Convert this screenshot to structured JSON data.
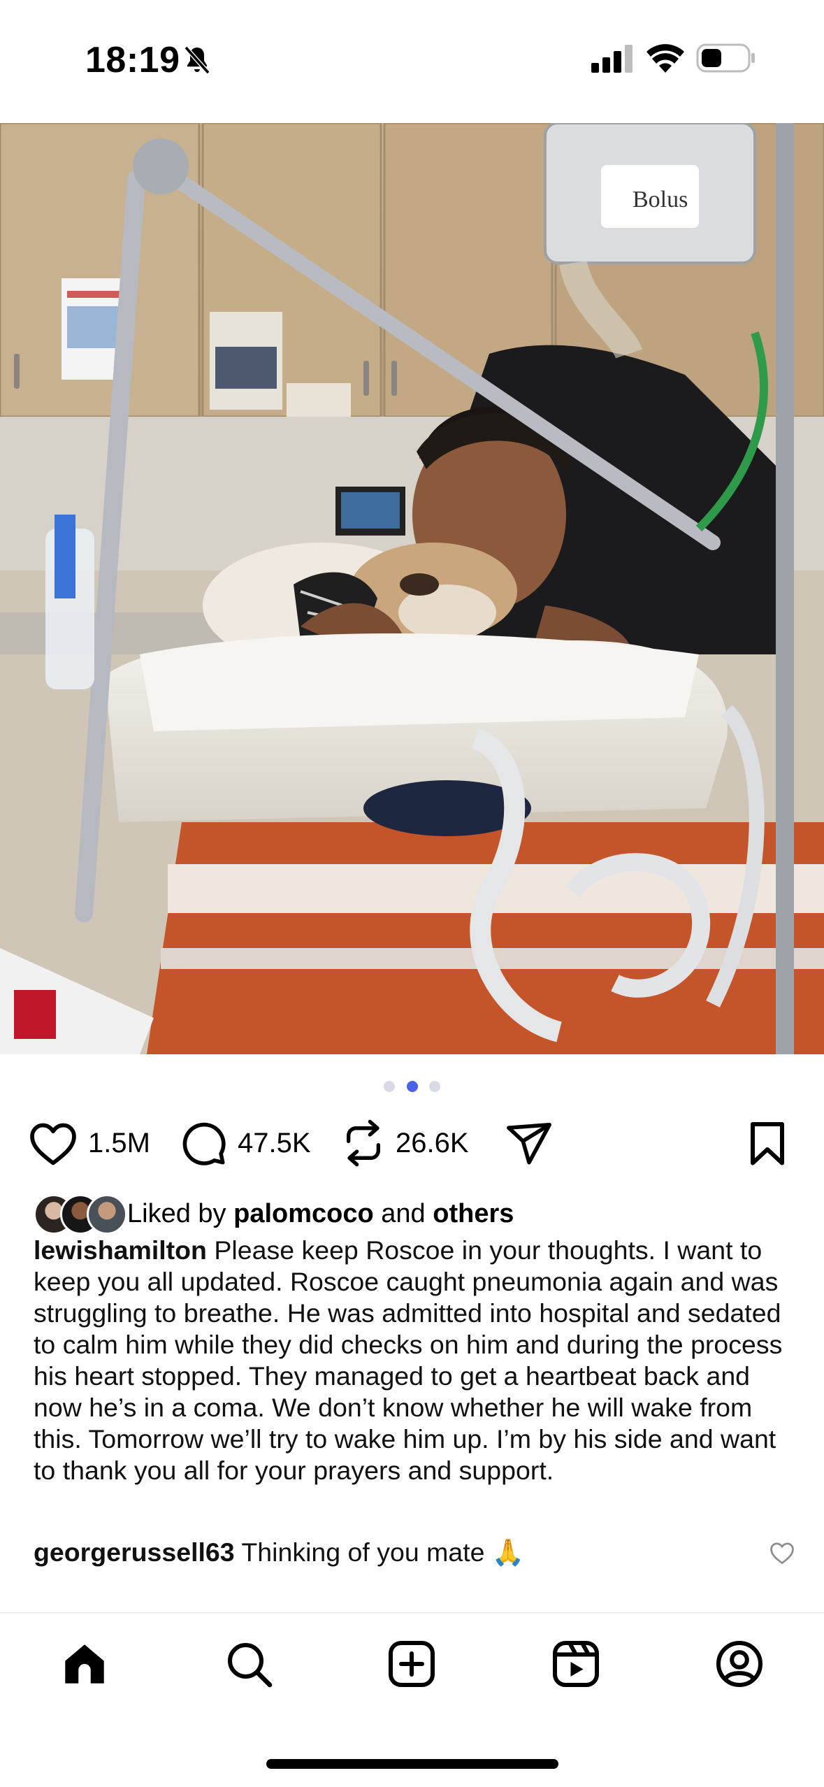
{
  "status_bar": {
    "time": "18:19",
    "icons": [
      "bell-slash-icon",
      "signal-icon",
      "wifi-icon",
      "battery-icon"
    ]
  },
  "post": {
    "image_alt": "Photo: person kissing a sedated bulldog in a veterinary hospital",
    "image_note_text": "Bolus",
    "carousel": {
      "total": 3,
      "active_index": 1
    },
    "actions": {
      "likes": "1.5M",
      "comments": "47.5K",
      "reposts": "26.6K"
    },
    "liked_by": {
      "prefix": "Liked by",
      "user": "palomcoco",
      "joiner": "and",
      "others": "others"
    },
    "caption": {
      "user": "lewishamilton",
      "text": "Please keep Roscoe in your thoughts. I want to keep you all updated. Roscoe caught pneumonia again and was struggling to breathe. He was admitted into hospital and sedated to calm him while they did checks on him and during the process his heart stopped. They managed to get a heartbeat back and now he’s in a coma. We don’t know whether he will wake from this. Tomorrow we’ll try to wake him up. I’m by his side and want to thank you all for your prayers and support."
    },
    "top_comment": {
      "user": "georgerussell63",
      "text": "Thinking of you mate 🙏"
    }
  },
  "bottom_nav": {
    "items": [
      "home-icon",
      "search-icon",
      "create-icon",
      "reels-icon",
      "profile-icon"
    ],
    "active": "home-icon"
  },
  "colors": {
    "accent_dot": "#4a63e6",
    "inactive_dot": "#d8dbe6"
  }
}
